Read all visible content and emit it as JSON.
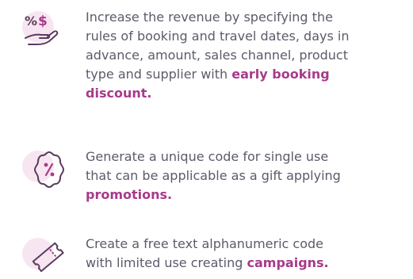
{
  "features": [
    {
      "icon": "discount-hand-icon",
      "lines": [
        "Increase the revenue by specifying the",
        "rules of booking and travel dates, days in",
        "advance, amount, sales channel, product",
        "type and supplier with "
      ],
      "highlight_line4": "early booking",
      "highlight_line5": "discount."
    },
    {
      "icon": "promo-badge-icon",
      "lines": [
        "Generate a unique code for single use",
        "that can be applicable as a gift applying"
      ],
      "highlight_line3": "promotions."
    },
    {
      "icon": "ticket-icon",
      "lines": [
        "Create a free text alphanumeric code",
        "with limited use creating "
      ],
      "highlight_line2": "campaigns."
    }
  ],
  "colors": {
    "text": "#5b5b6b",
    "accent": "#a83a8a",
    "icon_bg": "#f7e6f1",
    "icon_stroke": "#5a3a5e"
  }
}
